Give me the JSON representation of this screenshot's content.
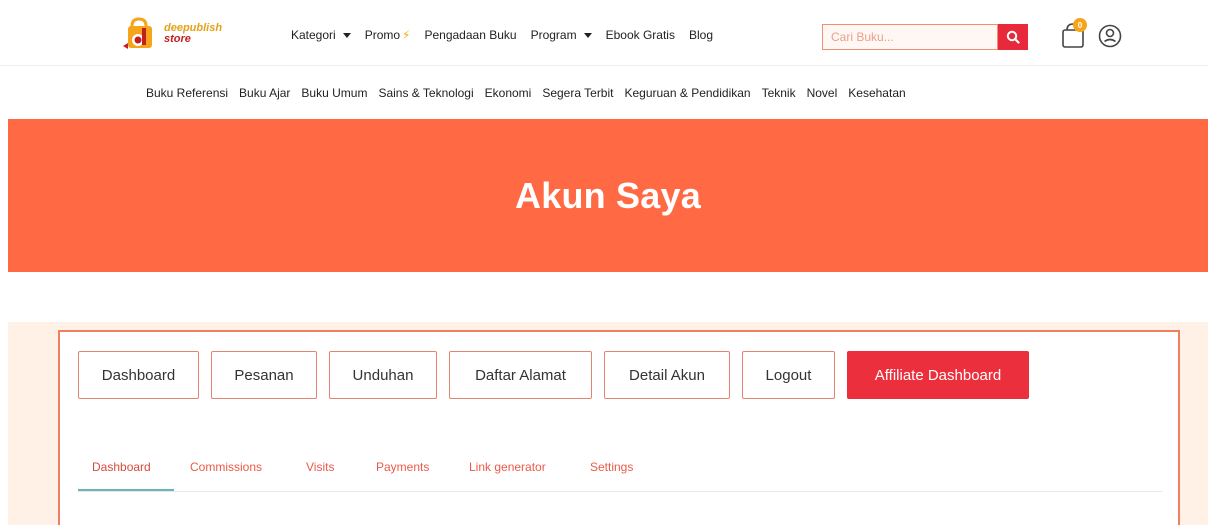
{
  "brand": {
    "line1": "deepublish",
    "line2": "store",
    "colors": {
      "primary": "#ff6a45",
      "accent": "#ec2f3c",
      "gold": "#f6a51a"
    }
  },
  "nav": {
    "items": [
      {
        "label": "Kategori",
        "dropdown": true
      },
      {
        "label": "Promo",
        "icon": "lightning-icon"
      },
      {
        "label": "Pengadaan Buku"
      },
      {
        "label": "Program",
        "dropdown": true
      },
      {
        "label": "Ebook Gratis"
      },
      {
        "label": "Blog"
      }
    ]
  },
  "search": {
    "placeholder": "Cari Buku...",
    "icon": "search-icon"
  },
  "cart": {
    "count": "0",
    "icon": "shopping-bag-icon"
  },
  "user": {
    "icon": "user-circle-icon"
  },
  "categories": [
    "Buku Referensi",
    "Buku Ajar",
    "Buku Umum",
    "Sains & Teknologi",
    "Ekonomi",
    "Segera Terbit",
    "Keguruan & Pendidikan",
    "Teknik",
    "Novel",
    "Kesehatan"
  ],
  "page": {
    "title": "Akun Saya"
  },
  "account_nav": {
    "buttons": [
      {
        "label": "Dashboard",
        "active": false
      },
      {
        "label": "Pesanan",
        "active": false
      },
      {
        "label": "Unduhan",
        "active": false
      },
      {
        "label": "Daftar Alamat",
        "active": false
      },
      {
        "label": "Detail Akun",
        "active": false
      },
      {
        "label": "Logout",
        "active": false
      },
      {
        "label": "Affiliate Dashboard",
        "active": true
      }
    ]
  },
  "affiliate_tabs": {
    "items": [
      {
        "label": "Dashboard",
        "active": true
      },
      {
        "label": "Commissions",
        "active": false
      },
      {
        "label": "Visits",
        "active": false
      },
      {
        "label": "Payments",
        "active": false
      },
      {
        "label": "Link generator",
        "active": false
      },
      {
        "label": "Settings",
        "active": false
      }
    ]
  }
}
